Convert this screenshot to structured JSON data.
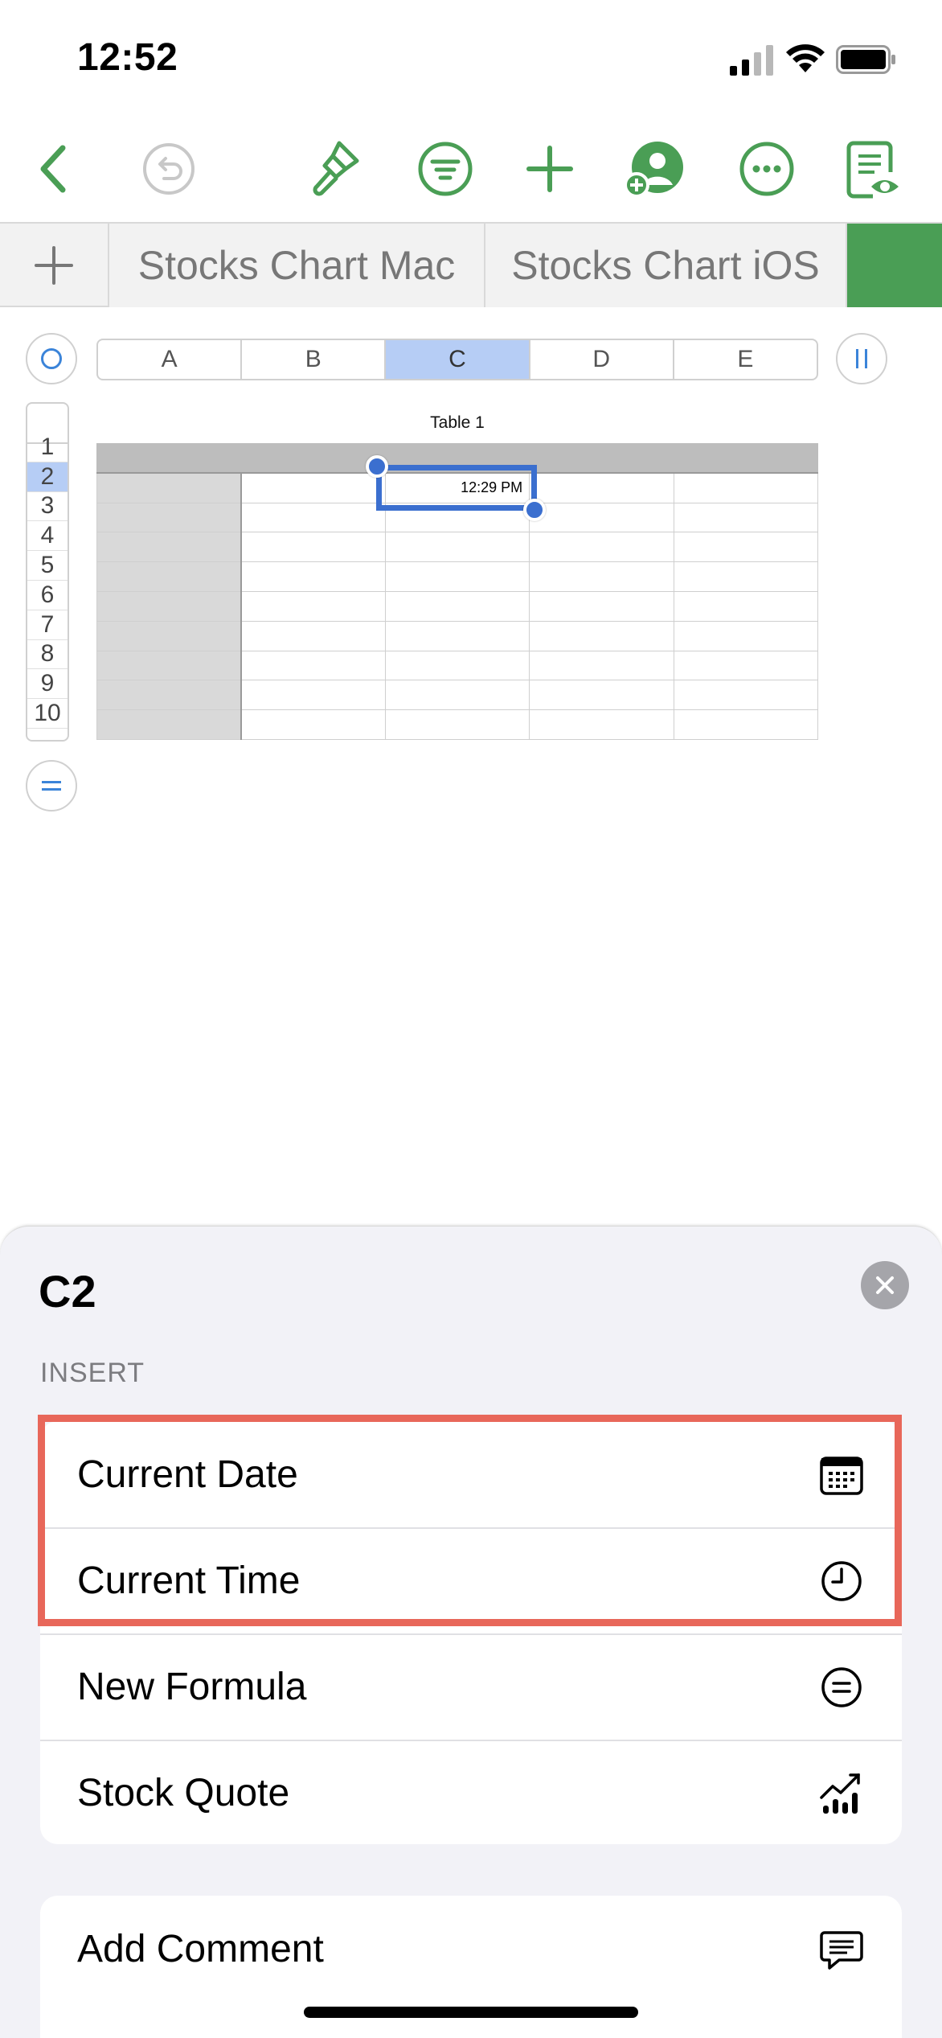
{
  "status_bar": {
    "time": "12:52"
  },
  "toolbar": {
    "icons": [
      "back-icon",
      "undo-icon",
      "format-brush-icon",
      "filter-icon",
      "add-icon",
      "collaborate-icon",
      "more-icon",
      "reader-view-icon"
    ]
  },
  "tabs": {
    "items": [
      {
        "label": "Stocks Chart Mac"
      },
      {
        "label": "Stocks Chart iOS"
      }
    ]
  },
  "table": {
    "title": "Table 1",
    "columns": [
      "A",
      "B",
      "C",
      "D",
      "E"
    ],
    "selected_column": "C",
    "rows": [
      "1",
      "2",
      "3",
      "4",
      "5",
      "6",
      "7",
      "8",
      "9",
      "10"
    ],
    "selected_row": "2",
    "selected_cell_value": "12:29 PM"
  },
  "sheet": {
    "title": "C2",
    "section_label": "INSERT",
    "insert_items": [
      {
        "label": "Current Date",
        "icon": "calendar-icon"
      },
      {
        "label": "Current Time",
        "icon": "clock-icon"
      },
      {
        "label": "New Formula",
        "icon": "equals-icon"
      },
      {
        "label": "Stock Quote",
        "icon": "stock-chart-icon"
      }
    ],
    "other_items": [
      {
        "label": "Add Comment",
        "icon": "comment-icon"
      }
    ]
  },
  "colors": {
    "accent_green": "#4a9e55",
    "selection_blue": "#3b6fcf",
    "highlight_red": "#e8675a"
  }
}
